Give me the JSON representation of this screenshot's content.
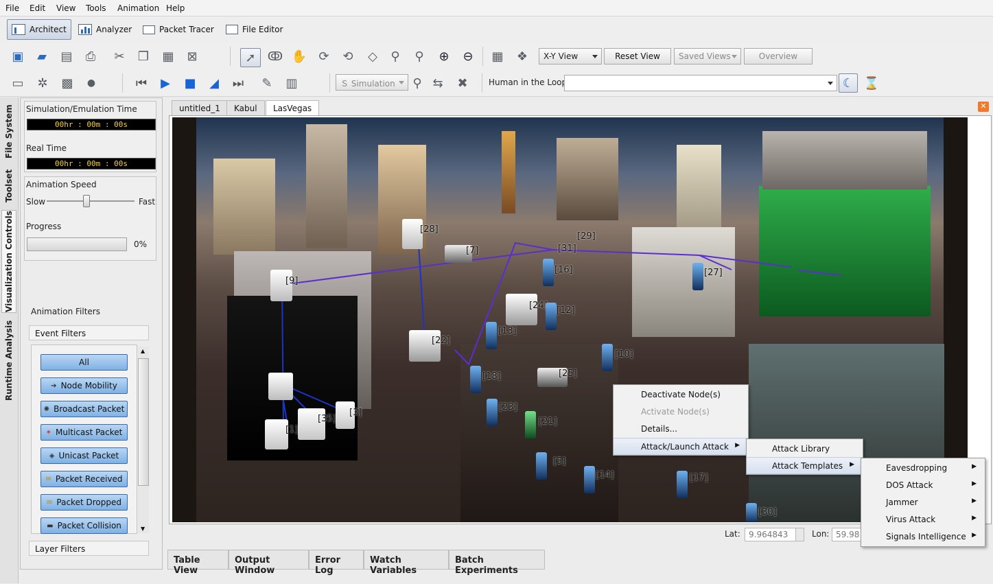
{
  "menubar": {
    "file": "File",
    "edit": "Edit",
    "view": "View",
    "tools": "Tools",
    "animation": "Animation",
    "help": "Help"
  },
  "modes": {
    "architect": "Architect",
    "analyzer": "Analyzer",
    "packet_tracer": "Packet Tracer",
    "file_editor": "File Editor"
  },
  "toolbar": {
    "view_select": "X-Y View",
    "reset_view": "Reset View",
    "saved_views": "Saved Views",
    "overview": "Overview",
    "simulation_select": "Simulation",
    "hil_label": "Human in the Loop:",
    "hil_value": ""
  },
  "sidetabs": {
    "file_system": "File System",
    "toolset": "Toolset",
    "visualization_controls": "Visualization Controls",
    "runtime_analysis": "Runtime Analysis"
  },
  "panel": {
    "sim_time_label": "Simulation/Emulation Time",
    "sim_time": "00hr : 00m : 00s",
    "real_time_label": "Real Time",
    "real_time": "00hr : 00m : 00s",
    "speed_label": "Animation Speed",
    "slow": "Slow",
    "fast": "Fast",
    "speed_level": 0.45,
    "progress_label": "Progress",
    "progress_value": "0%",
    "filters_label": "Animation Filters",
    "event_filters": "Event Filters",
    "layer_filters": "Layer Filters",
    "filters": [
      "All",
      "Node Mobility",
      "Broadcast Packet",
      "Multicast Packet",
      "Unicast Packet",
      "Packet Received",
      "Packet Dropped",
      "Packet Collision"
    ]
  },
  "doc_tabs": [
    "untitled_1",
    "Kabul",
    "LasVegas"
  ],
  "nodes": [
    "[28]",
    "[7]",
    "[31]",
    "[29]",
    "[16]",
    "[27]",
    "[9]",
    "[24]",
    "[12]",
    "[13]",
    "[22]",
    "[10]",
    "[18]",
    "[25]",
    "[23]",
    "[21]",
    "[5]",
    "[14]",
    "[17]",
    "[30]",
    "[3]",
    "[35]",
    "[1]"
  ],
  "coords": {
    "lat_label": "Lat:",
    "lat_value": "9.964843",
    "lon_label": "Lon:",
    "lon_value": "59.98"
  },
  "bottom_tabs": [
    "Table View",
    "Output Window",
    "Error Log",
    "Watch Variables",
    "Batch Experiments"
  ],
  "context_menu": {
    "items": [
      "Deactivate Node(s)",
      "Activate Node(s)",
      "Details...",
      "Attack/Launch Attack"
    ],
    "submenu": [
      "Attack Library",
      "Attack Templates"
    ],
    "templates": [
      "Eavesdropping",
      "DOS Attack",
      "Jammer",
      "Virus Attack",
      "Signals Intelligence"
    ]
  },
  "colors": {
    "accent": "#2b6cc0",
    "link": "#5a2ed0",
    "menu_highlight": "#d6e0ef",
    "close": "#f07a2a"
  }
}
